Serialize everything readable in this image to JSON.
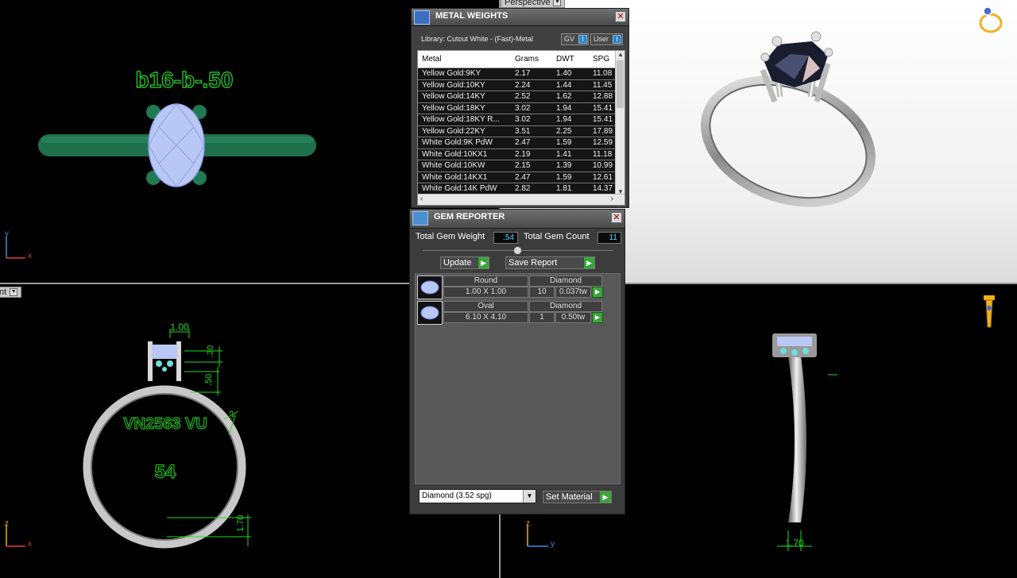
{
  "viewports": {
    "top": {
      "annotation_top": "b16-b-.50",
      "axis_y": "y",
      "axis_x": "x"
    },
    "perspective": {
      "label": "Perspective"
    },
    "front": {
      "label": "nt",
      "annotation_width": "1.00",
      "annotation_30": ".30",
      "annotation_50": ".50",
      "annotation_2": ".2",
      "engraving": "VN2563 VU",
      "size": "54",
      "annotation_170": "1.70",
      "axis_z": "z",
      "axis_x": "x"
    },
    "right": {
      "annotation_170": "1.70",
      "axis_z": "z",
      "axis_y": "y"
    }
  },
  "metal_weights": {
    "title": "METAL WEIGHTS",
    "library_text": "Library: Cutout White - (Fast)-Metal",
    "toggle_gv": "GV",
    "toggle_user": "User",
    "toggle_state": "I",
    "columns": [
      "Metal",
      "Grams",
      "DWT",
      "SPG"
    ],
    "rows": [
      {
        "metal": "Yellow Gold:9KY",
        "grams": "2.17",
        "dwt": "1.40",
        "spg": "11.08"
      },
      {
        "metal": "Yellow Gold:10KY",
        "grams": "2.24",
        "dwt": "1.44",
        "spg": "11.45"
      },
      {
        "metal": "Yellow Gold:14KY",
        "grams": "2.52",
        "dwt": "1.62",
        "spg": "12.88"
      },
      {
        "metal": "Yellow Gold:18KY",
        "grams": "3.02",
        "dwt": "1.94",
        "spg": "15.41"
      },
      {
        "metal": "Yellow Gold:18KY R...",
        "grams": "3.02",
        "dwt": "1.94",
        "spg": "15.41"
      },
      {
        "metal": "Yellow Gold:22KY",
        "grams": "3.51",
        "dwt": "2.25",
        "spg": "17.89"
      },
      {
        "metal": "White Gold:9K PdW",
        "grams": "2.47",
        "dwt": "1.59",
        "spg": "12.59"
      },
      {
        "metal": "White Gold:10KX1",
        "grams": "2.19",
        "dwt": "1.41",
        "spg": "11.18"
      },
      {
        "metal": "White Gold:10KW",
        "grams": "2.15",
        "dwt": "1.39",
        "spg": "10.99"
      },
      {
        "metal": "White Gold:14KX1",
        "grams": "2.47",
        "dwt": "1.59",
        "spg": "12.61"
      },
      {
        "metal": "White Gold:14K PdW",
        "grams": "2.82",
        "dwt": "1.81",
        "spg": "14.37"
      }
    ]
  },
  "gem_reporter": {
    "title": "GEM REPORTER",
    "total_weight_label": "Total Gem Weight",
    "total_weight_value": ".54",
    "total_count_label": "Total Gem Count",
    "total_count_value": "11",
    "update_label": "Update",
    "save_report_label": "Save Report",
    "gems": [
      {
        "shape": "Round",
        "material": "Diamond",
        "size": "1.00 X 1.00",
        "count": "10",
        "weight": "0.037tw"
      },
      {
        "shape": "Oval",
        "material": "Diamond",
        "size": "6.10 X 4.10",
        "count": "1",
        "weight": "0.50tw"
      }
    ],
    "material_select": "Diamond    (3.52 spg)",
    "set_material_label": "Set Material"
  },
  "colors": {
    "annotation_green": "#22dd22",
    "shank_green": "#1f6e4c",
    "gem_blue": "#b9c7f5",
    "accent_blue": "#2a88c8",
    "play_green": "#3aa53a"
  }
}
